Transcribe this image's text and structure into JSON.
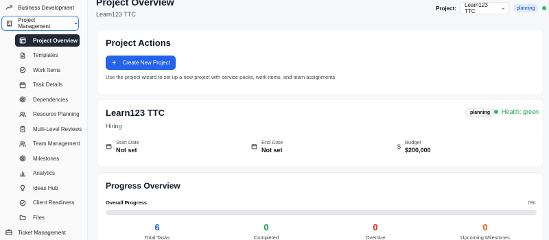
{
  "sidebar": {
    "top_item": "Business Development",
    "group": "Project Management",
    "items": [
      {
        "label": "Project Overview",
        "icon": "layout-icon",
        "active": true
      },
      {
        "label": "Templates",
        "icon": "file-icon"
      },
      {
        "label": "Work Items",
        "icon": "check-circle-icon"
      },
      {
        "label": "Task Details",
        "icon": "calendar-icon"
      },
      {
        "label": "Dependencies",
        "icon": "target-icon"
      },
      {
        "label": "Resource Planning",
        "icon": "users-icon"
      },
      {
        "label": "Multi-Level Reviews",
        "icon": "clipboard-icon"
      },
      {
        "label": "Team Management",
        "icon": "users-icon"
      },
      {
        "label": "Milestones",
        "icon": "target-icon"
      },
      {
        "label": "Analytics",
        "icon": "bar-chart-icon"
      },
      {
        "label": "Ideas Hub",
        "icon": "lightbulb-icon"
      },
      {
        "label": "Client Readiness",
        "icon": "check-circle-icon"
      },
      {
        "label": "Files",
        "icon": "folder-icon"
      }
    ],
    "bottom_item": "Ticket Management"
  },
  "header": {
    "title": "Project Overview",
    "subtitle": "Learn123 TTC",
    "project_label": "Project:",
    "project_selected": "Learn123 TTC",
    "status": "planning"
  },
  "actions": {
    "title": "Project Actions",
    "button": "Create New Project",
    "help": "Use the project wizard to set up a new project with service packs, work items, and team assignments"
  },
  "project": {
    "name": "Learn123 TTC",
    "type": "Hiring",
    "status": "planning",
    "health": "Health: green",
    "start_label": "Start Date",
    "start_value": "Not set",
    "end_label": "End Date",
    "end_value": "Not set",
    "budget_label": "Budget",
    "budget_value": "$200,000"
  },
  "progress": {
    "title": "Progress Overview",
    "overall_label": "Overall Progress",
    "overall_pct": "0%",
    "fill": 0,
    "stats": [
      {
        "value": "6",
        "label": "Total Tasks",
        "color": "#2563eb"
      },
      {
        "value": "0",
        "label": "Completed",
        "color": "#16a34a"
      },
      {
        "value": "0",
        "label": "Overdue",
        "color": "#dc2626"
      },
      {
        "value": "0",
        "label": "Upcoming Milestones",
        "color": "#ea580c"
      }
    ]
  },
  "colors": {
    "accent": "#2563eb",
    "health": "#16a34a"
  }
}
